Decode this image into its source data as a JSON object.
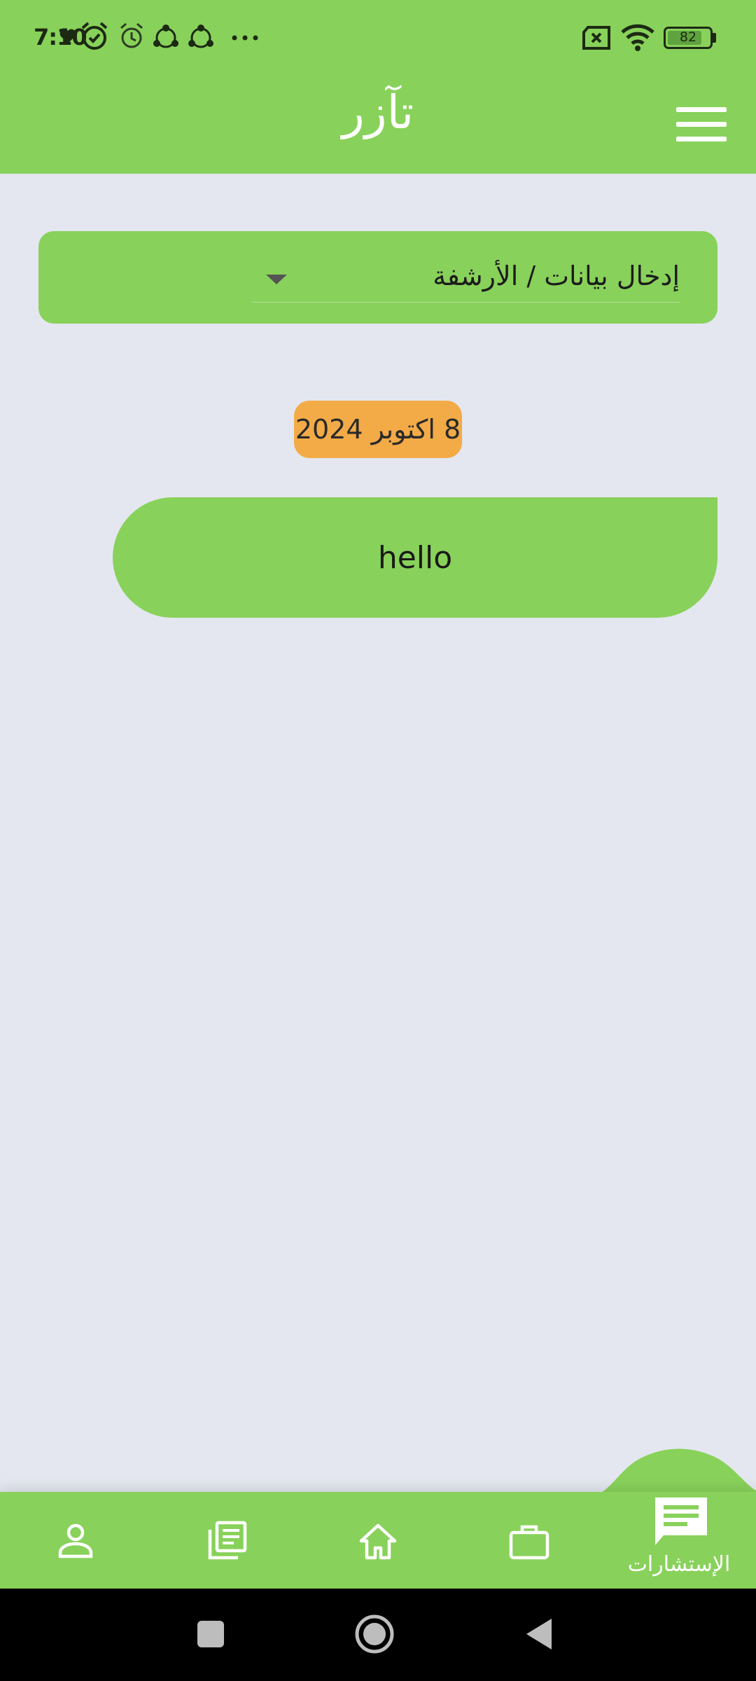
{
  "status_bar": {
    "time": "7:10",
    "battery_percent": 82,
    "battery_label": "82",
    "icons": [
      "heart-icon",
      "alarm-icon",
      "alarm-outline-icon",
      "share-app-icon",
      "share-app-icon",
      "more-dots-icon",
      "sim-error-icon",
      "wifi-icon",
      "battery-icon"
    ]
  },
  "app_bar": {
    "title": "تآزر",
    "menu_icon": "hamburger-menu-icon"
  },
  "dropdown": {
    "selected_value": "إدخال بيانات / الأرشفة"
  },
  "chat": {
    "date_label": "8 اكتوبر 2024",
    "messages": [
      {
        "text": "hello"
      }
    ]
  },
  "bottom_nav": {
    "items": [
      {
        "icon": "person-icon"
      },
      {
        "icon": "library-books-icon"
      },
      {
        "icon": "home-icon"
      },
      {
        "icon": "briefcase-icon"
      },
      {
        "icon": "chat-icon",
        "label": "الإستشارات",
        "active": true
      }
    ]
  },
  "colors": {
    "primary": "#88d25b",
    "background": "#e4e7ef",
    "date_chip": "#f2ab46",
    "system_nav": "#000000"
  }
}
